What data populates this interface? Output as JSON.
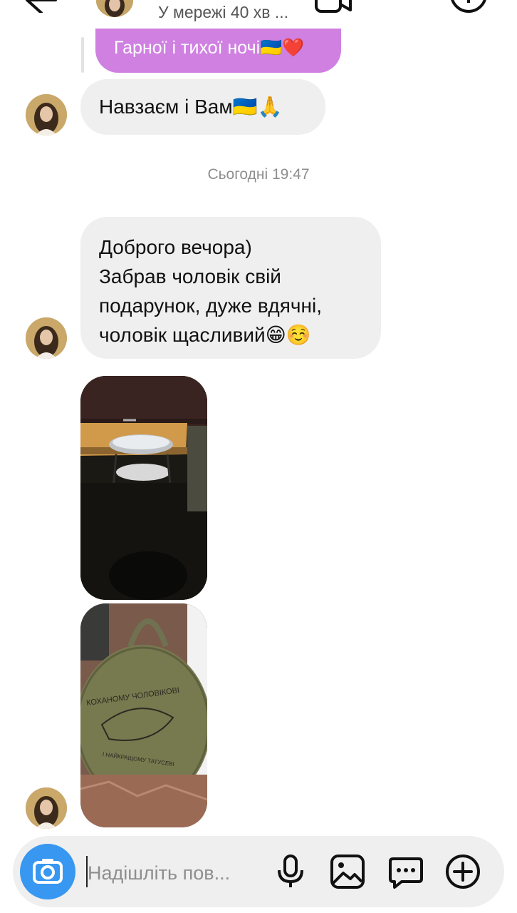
{
  "header": {
    "status": "У мережі 40 хв ..."
  },
  "messages": {
    "outgoing": {
      "text": "Гарної і тихої ночі🇺🇦❤️"
    },
    "incoming_1": {
      "text": "Навзаєм і Вам🇺🇦🙏"
    },
    "timestamp": "Сьогодні 19:47",
    "incoming_2": {
      "text": "Доброго вечора)\nЗабрав чоловік свій\nподарунок, дуже вдячні,\nчоловік щасливий😁☺️"
    },
    "photos": [
      {
        "description_icon": "photo-grill-icon"
      },
      {
        "description_icon": "photo-bag-icon",
        "print_line_1": "КОХАНОМУ ЧОЛОВІКОВІ",
        "print_line_2": "І НАЙКРАЩОМУ ТАТУСЕВІ"
      }
    ]
  },
  "composer": {
    "placeholder": "Надішліть пов..."
  },
  "icons": {
    "back": "arrow-left-icon",
    "video": "video-call-icon",
    "call": "phone-icon",
    "info": "info-icon",
    "camera": "camera-icon",
    "mic": "microphone-icon",
    "gallery": "gallery-icon",
    "sticker": "sticker-icon",
    "plus": "plus-icon"
  },
  "colors": {
    "outgoing_bubble": "#cf80e1",
    "incoming_bubble": "#efefef",
    "camera_button": "#3897f0",
    "timestamp": "#8e8e8e"
  }
}
